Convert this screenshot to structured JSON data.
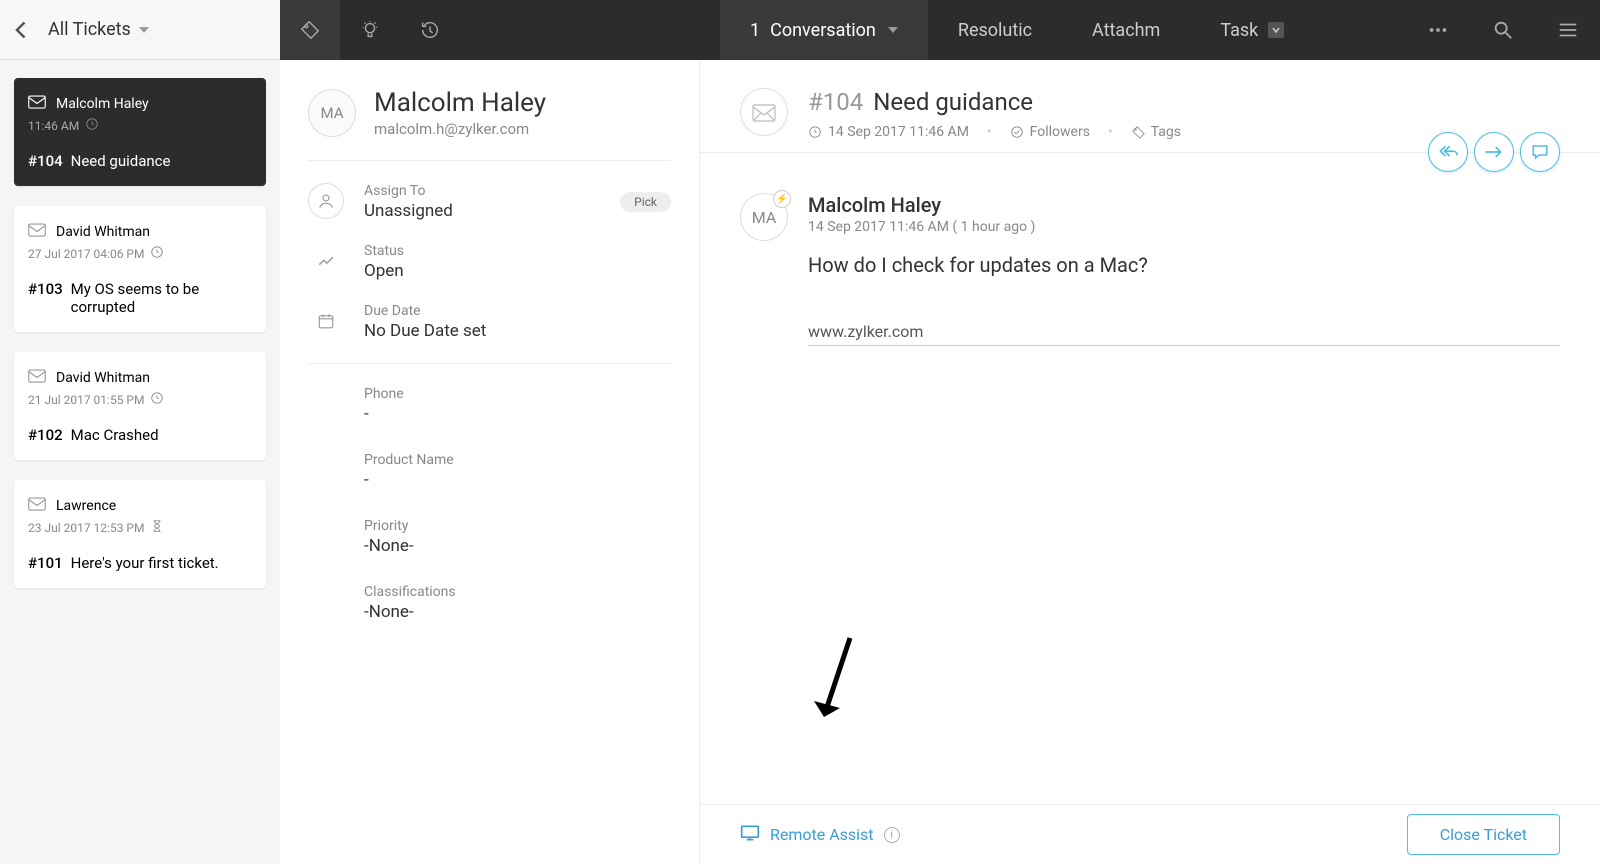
{
  "header": {
    "list_title": "All Tickets",
    "tabs": [
      {
        "label": "Conversation",
        "count": "1",
        "active": true
      },
      {
        "label": "Resolution",
        "truncated": "Resolutic"
      },
      {
        "label": "Attachment",
        "truncated": "Attachm"
      },
      {
        "label": "Task"
      }
    ]
  },
  "tickets": [
    {
      "name": "Malcolm Haley",
      "time": "11:46 AM",
      "id": "#104",
      "subject": "Need guidance",
      "active": true
    },
    {
      "name": "David Whitman",
      "time": "27 Jul 2017 04:06 PM",
      "id": "#103",
      "subject": "My OS seems to be corrupted"
    },
    {
      "name": "David Whitman",
      "time": "21 Jul 2017 01:55 PM",
      "id": "#102",
      "subject": "Mac Crashed"
    },
    {
      "name": "Lawrence",
      "time": "23 Jul 2017 12:53 PM",
      "id": "#101",
      "subject": "Here's your first ticket."
    }
  ],
  "detail": {
    "avatar": "MA",
    "name": "Malcolm Haley",
    "email": "malcolm.h@zylker.com",
    "assign_label": "Assign To",
    "assign_value": "Unassigned",
    "pick": "Pick",
    "status_label": "Status",
    "status_value": "Open",
    "due_label": "Due Date",
    "due_value": "No Due Date set",
    "phone_label": "Phone",
    "phone_value": "-",
    "product_label": "Product Name",
    "product_value": "-",
    "priority_label": "Priority",
    "priority_value": "-None-",
    "class_label": "Classifications",
    "class_value": "-None-"
  },
  "conversation": {
    "id": "#104",
    "subject": "Need guidance",
    "datetime": "14 Sep 2017 11:46 AM",
    "followers": "Followers",
    "tags": "Tags",
    "message": {
      "avatar": "MA",
      "author": "Malcolm Haley",
      "time": "14 Sep 2017 11:46 AM ( 1 hour ago )",
      "body": "How do I check for updates on a Mac?",
      "link": "www.zylker.com"
    }
  },
  "footer": {
    "remote_assist": "Remote Assist",
    "close": "Close Ticket"
  }
}
